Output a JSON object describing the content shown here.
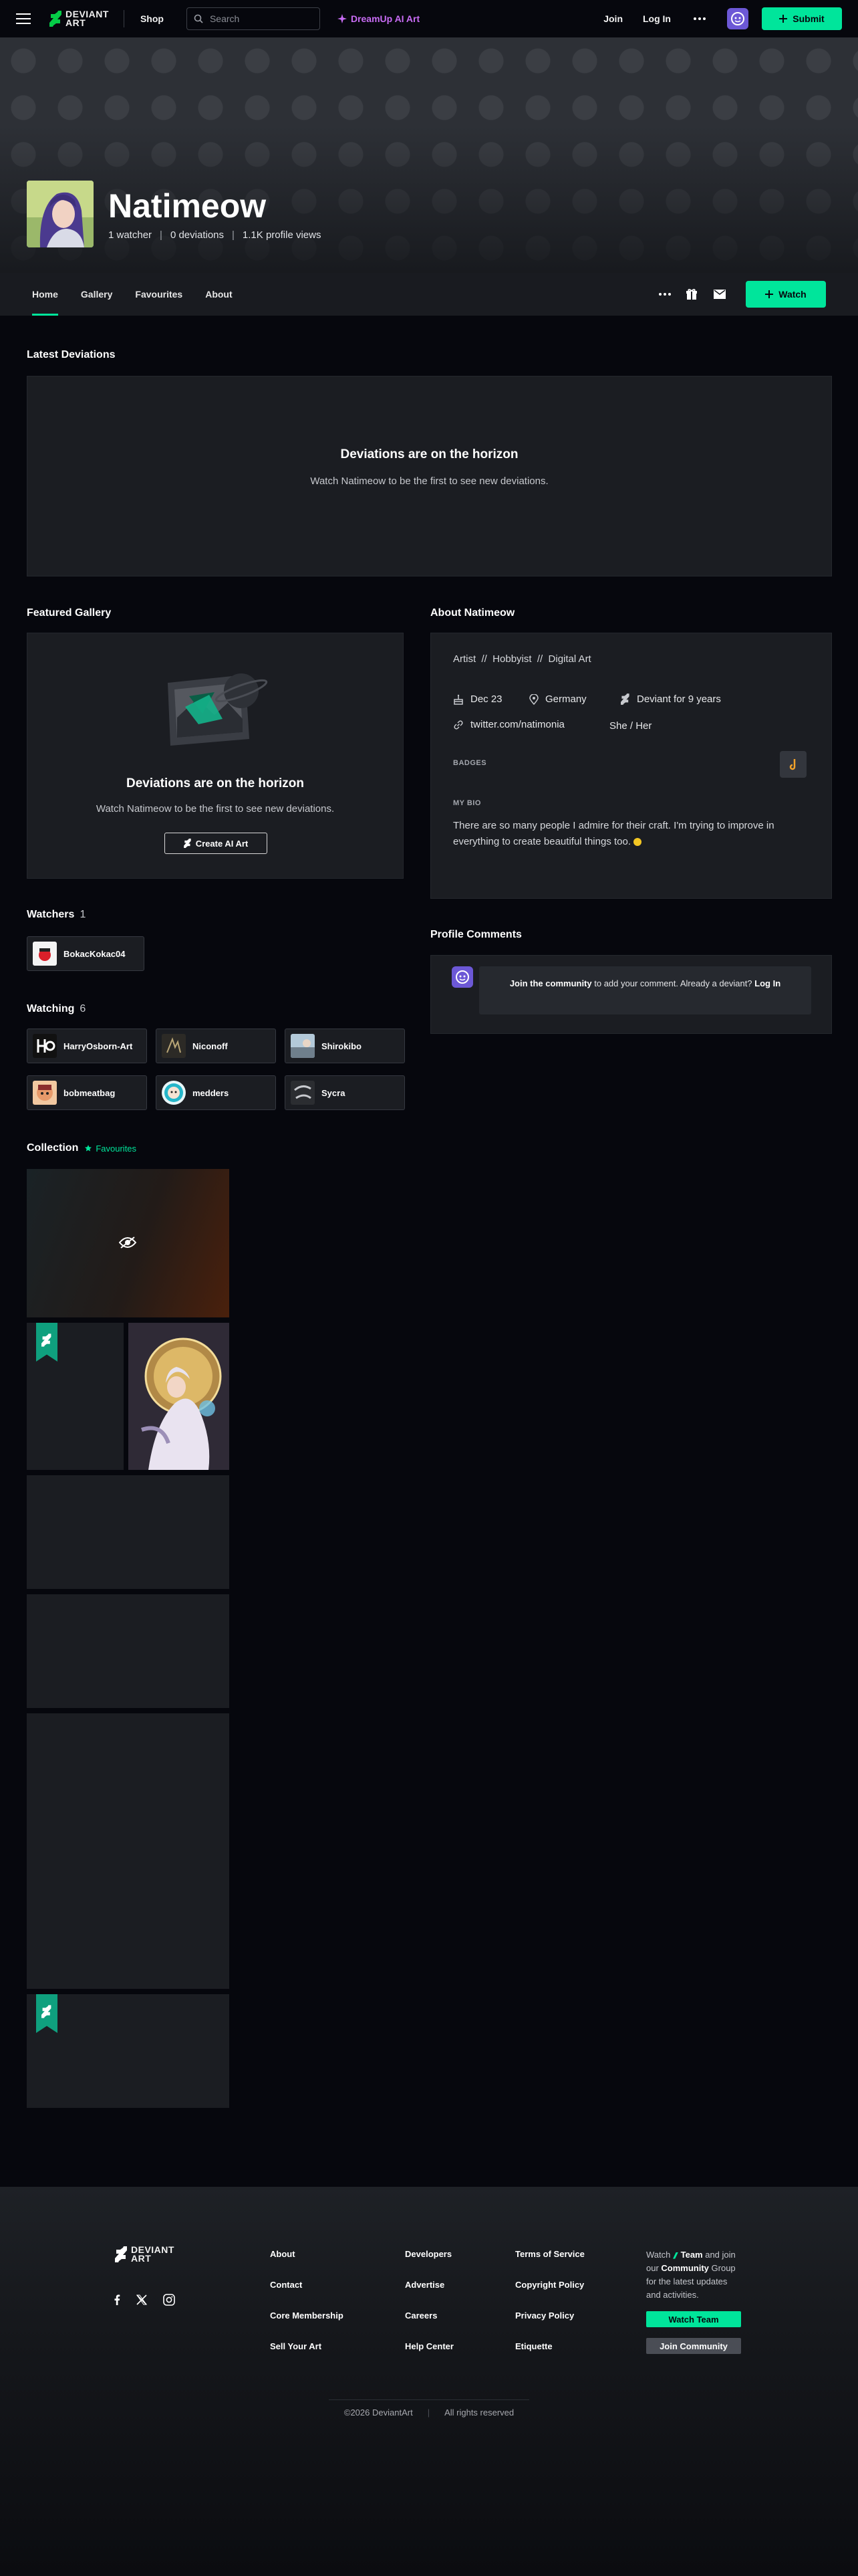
{
  "topbar": {
    "logo_line1": "DEVIANT",
    "logo_line2": "ART",
    "shop": "Shop",
    "search_placeholder": "Search",
    "dreamup": "DreamUp AI Art",
    "join": "Join",
    "login": "Log In",
    "submit": "Submit"
  },
  "profile": {
    "name": "Natimeow",
    "watchers": "1 watcher",
    "deviations": "0 deviations",
    "views": "1.1K profile views"
  },
  "tabs": [
    "Home",
    "Gallery",
    "Favourites",
    "About"
  ],
  "watch_label": "Watch",
  "latest": {
    "heading": "Latest Deviations",
    "title": "Deviations are on the horizon",
    "sub": "Watch Natimeow to be the first to see new deviations."
  },
  "featured": {
    "heading": "Featured Gallery",
    "title": "Deviations are on the horizon",
    "sub": "Watch Natimeow to be the first to see new deviations.",
    "button": "Create AI Art"
  },
  "watchers": {
    "heading": "Watchers",
    "count": "1",
    "users": [
      "BokacKokac04"
    ]
  },
  "watching": {
    "heading": "Watching",
    "count": "6",
    "users": [
      "HarryOsborn-Art",
      "Niconoff",
      "Shirokibo",
      "bobmeatbag",
      "medders",
      "Sycra"
    ]
  },
  "collection": {
    "heading": "Collection",
    "link": "Favourites"
  },
  "about": {
    "heading": "About Natimeow",
    "roles": "Artist  //  Hobbyist  //  Digital Art",
    "birthday": "Dec 23",
    "location": "Germany",
    "member": "Deviant for 9 years",
    "website": "twitter.com/natimonia",
    "pronouns": "She / Her",
    "badges_label": "BADGES",
    "bio_label": "MY BIO",
    "bio": "There are so many people I admire for their craft. I'm trying to improve in everything to create beautiful things too."
  },
  "comments": {
    "heading": "Profile Comments",
    "join_link": "Join the community",
    "text": " to add your comment. Already a deviant? ",
    "login_link": "Log In"
  },
  "footer": {
    "col1": [
      "About",
      "Contact",
      "Core Membership",
      "Sell Your Art"
    ],
    "col2": [
      "Developers",
      "Advertise",
      "Careers",
      "Help Center"
    ],
    "col3": [
      "Terms of Service",
      "Copyright Policy",
      "Privacy Policy",
      "Etiquette"
    ],
    "blurb_pre": "Watch ",
    "blurb_team": "Team",
    "blurb_mid": " and join our ",
    "blurb_community": "Community",
    "blurb_post": " Group for the latest updates and activities.",
    "watch_team": "Watch Team",
    "join_community": "Join Community",
    "copyright": "©2026 DeviantArt",
    "rights": "All rights reserved"
  },
  "colors": {
    "accent": "#00e59b",
    "dreamup": "#c86cf4",
    "panel": "#1b1d22",
    "background": "#06070d"
  }
}
